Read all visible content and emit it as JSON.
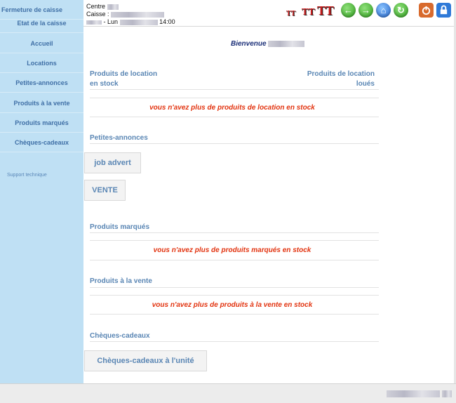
{
  "sidebar": {
    "items": [
      {
        "label": "Fermeture de caisse"
      },
      {
        "label": "Etat de la caisse"
      },
      {
        "label": "Accueil"
      },
      {
        "label": "Locations"
      },
      {
        "label": "Petites-annonces"
      },
      {
        "label": "Produits à la vente"
      },
      {
        "label": "Produits marqués"
      },
      {
        "label": "Chèques-cadeaux"
      }
    ],
    "support": "Support technique"
  },
  "header": {
    "centre_label": "Centre",
    "caisse_label": "Caisse :",
    "date_prefix": "- Lun",
    "time": "14:00"
  },
  "main": {
    "welcome": "Bienvenue",
    "stock_left": [
      "Produits de location",
      "en stock"
    ],
    "stock_right": [
      "Produits de location",
      "loués"
    ],
    "msg_location": "vous n'avez plus de produits de location en stock",
    "petites_annonces_title": "Petites-annonces",
    "job_advert": "job advert",
    "vente": "VENTE",
    "marques_title": "Produits marqués",
    "msg_marques": "vous n'avez plus de produits marqués en stock",
    "vente_title": "Produits à la vente",
    "msg_vente": "vous n'avez plus de produits à la vente en stock",
    "cheques_title": "Chèques-cadeaux",
    "cheques_button": "Chèques-cadeaux à l'unité"
  },
  "icons": {
    "tt1": "TT",
    "tt2": "TT",
    "tt3": "TT",
    "back_arrow": "←",
    "forward_arrow": "→",
    "home": "⌂",
    "refresh": "↻",
    "power": "⏻",
    "lock": "🔒"
  },
  "colors": {
    "sidebar_bg": "#bfe0f4",
    "link_blue": "#5a86b4",
    "alert_red": "#e2330f",
    "welcome_navy": "#1b2f78"
  }
}
